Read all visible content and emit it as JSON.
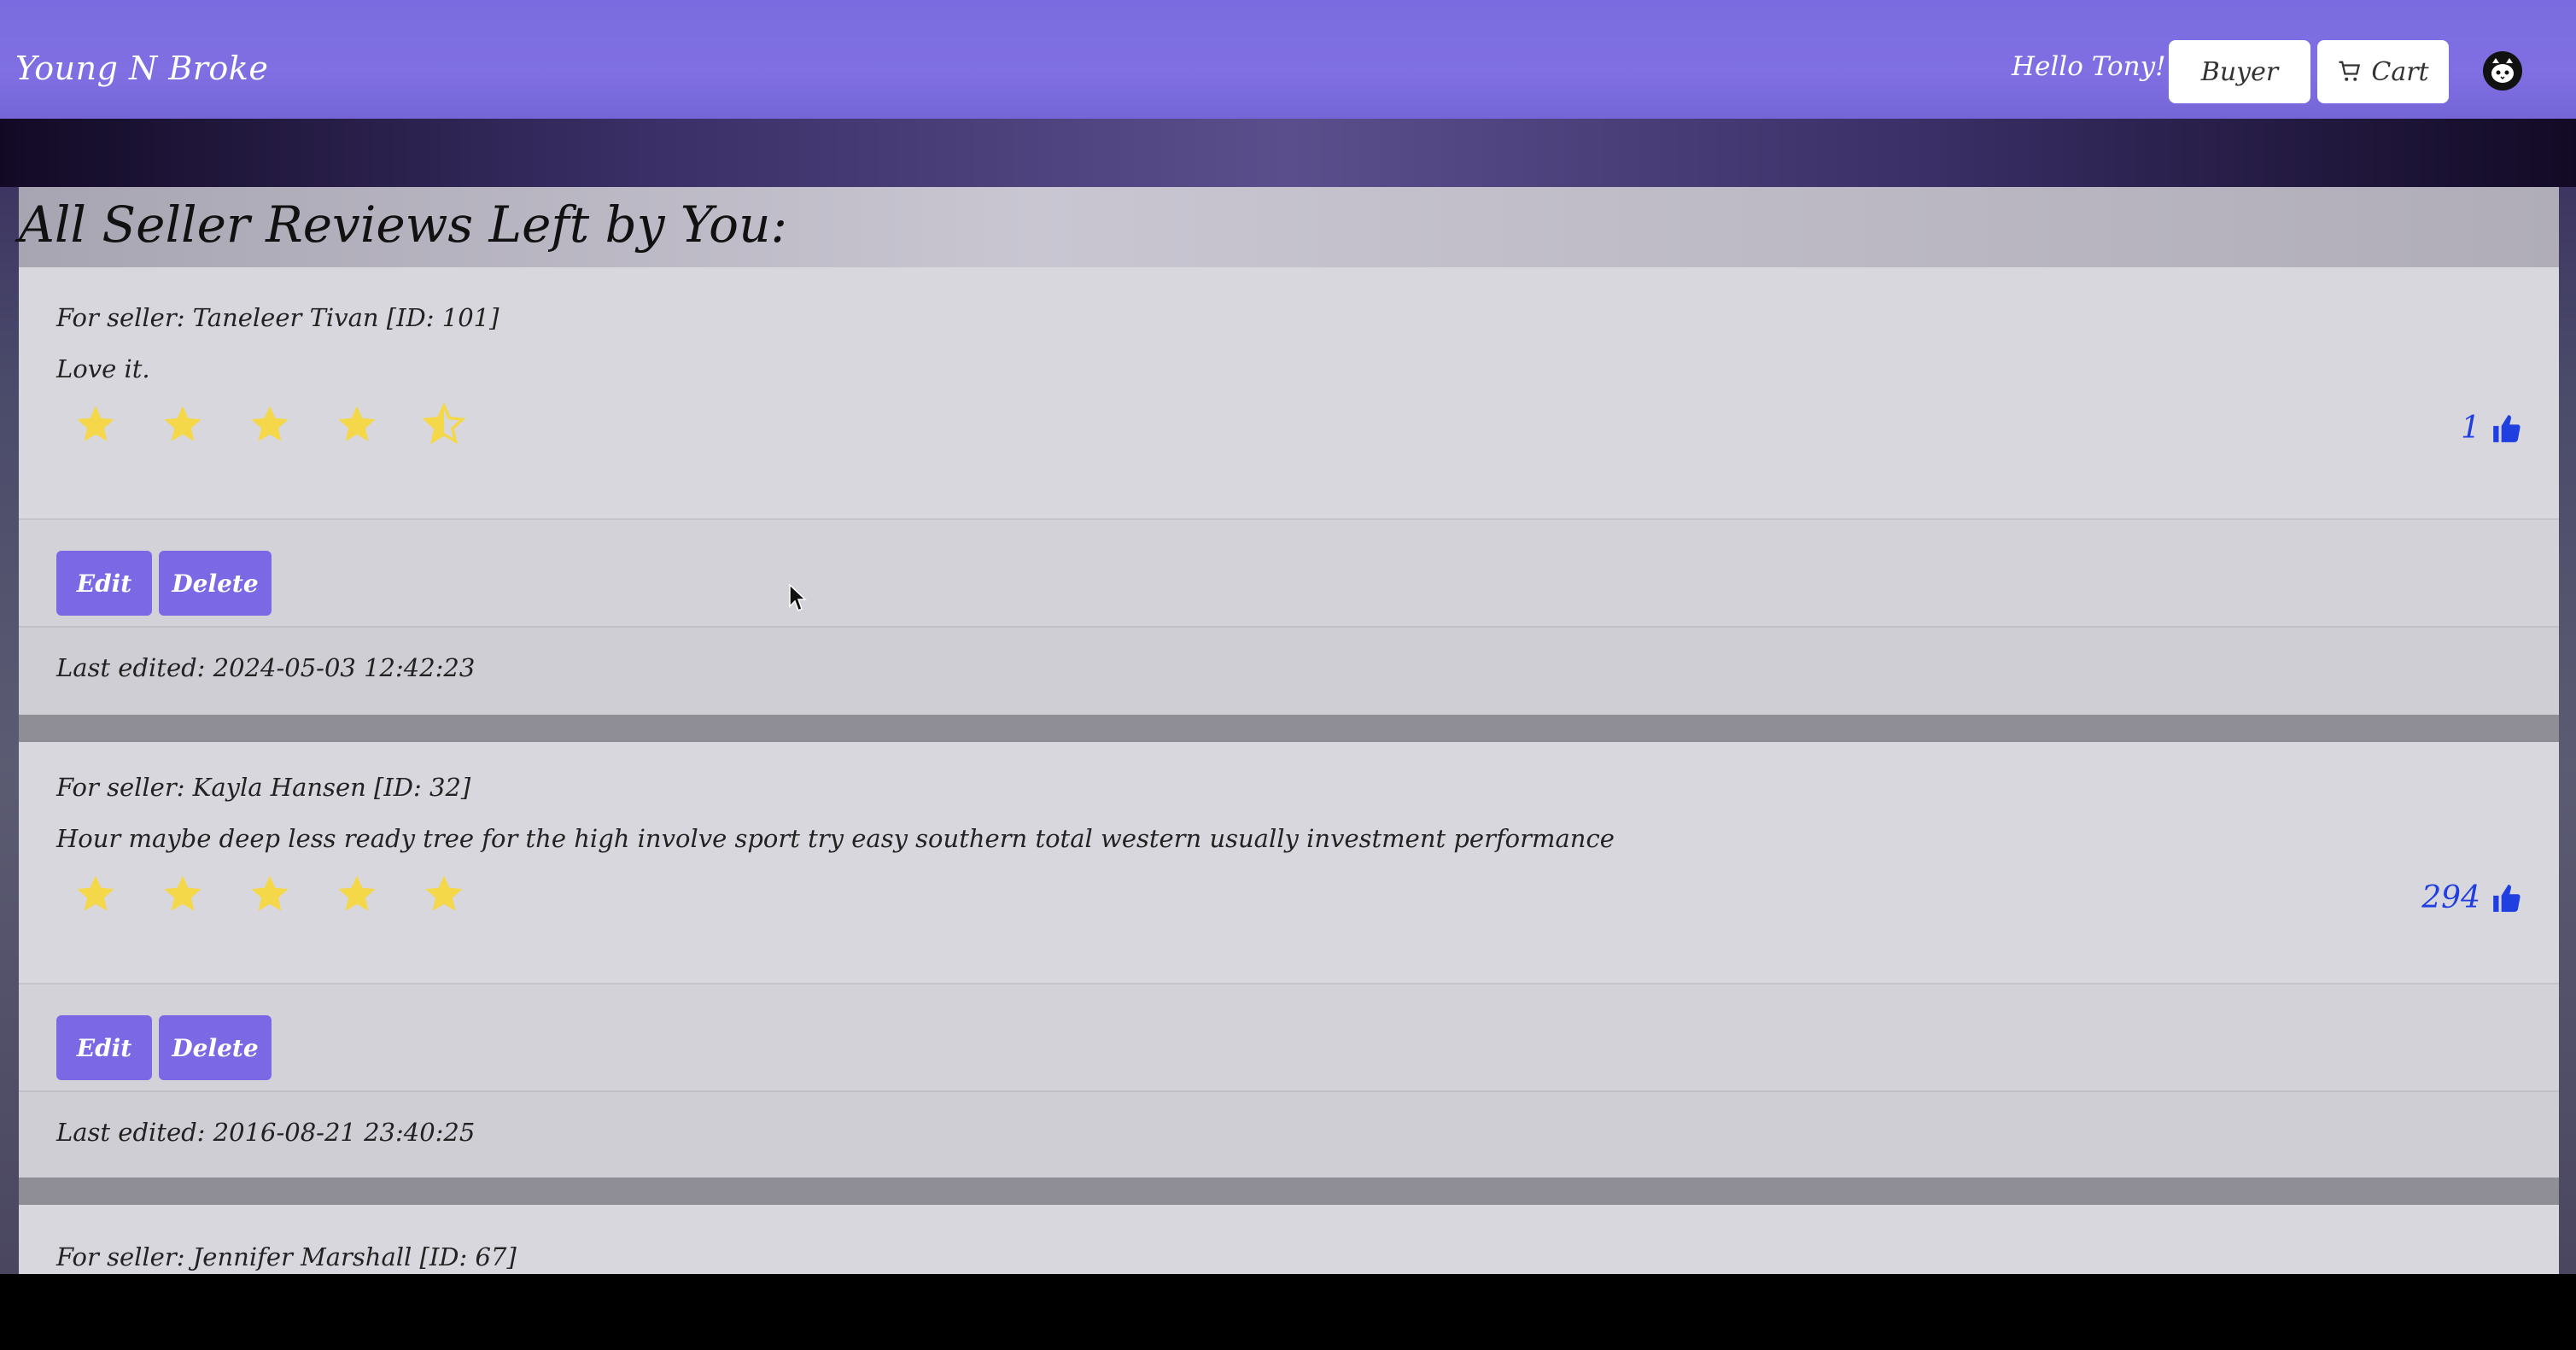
{
  "app": {
    "brand": "Young N Broke",
    "greeting": "Hello Tony!",
    "buyer_label": "Buyer",
    "cart_label": "Cart",
    "accent_color": "#7b68e4",
    "like_color": "#1f3fe0",
    "star_color": "#f5d84a"
  },
  "page": {
    "title": "All Seller Reviews Left by You:"
  },
  "reviews": [
    {
      "seller": "For seller: Taneleer Tivan [ID: 101]",
      "text": "Love it.",
      "rating": 4.5,
      "likes": "1",
      "edit_label": "Edit",
      "delete_label": "Delete",
      "last_edited": "Last edited: 2024-05-03 12:42:23"
    },
    {
      "seller": "For seller: Kayla Hansen [ID: 32]",
      "text": "Hour maybe deep less ready tree for the high involve sport try easy southern total western usually investment performance",
      "rating": 5,
      "likes": "294",
      "edit_label": "Edit",
      "delete_label": "Delete",
      "last_edited": "Last edited: 2016-08-21 23:40:25"
    },
    {
      "seller": "For seller: Jennifer Marshall [ID: 67]"
    }
  ],
  "icons": {
    "cart": "cart-icon",
    "profile": "cat-face-icon",
    "star": "star-icon",
    "thumb": "thumbs-up-icon"
  }
}
